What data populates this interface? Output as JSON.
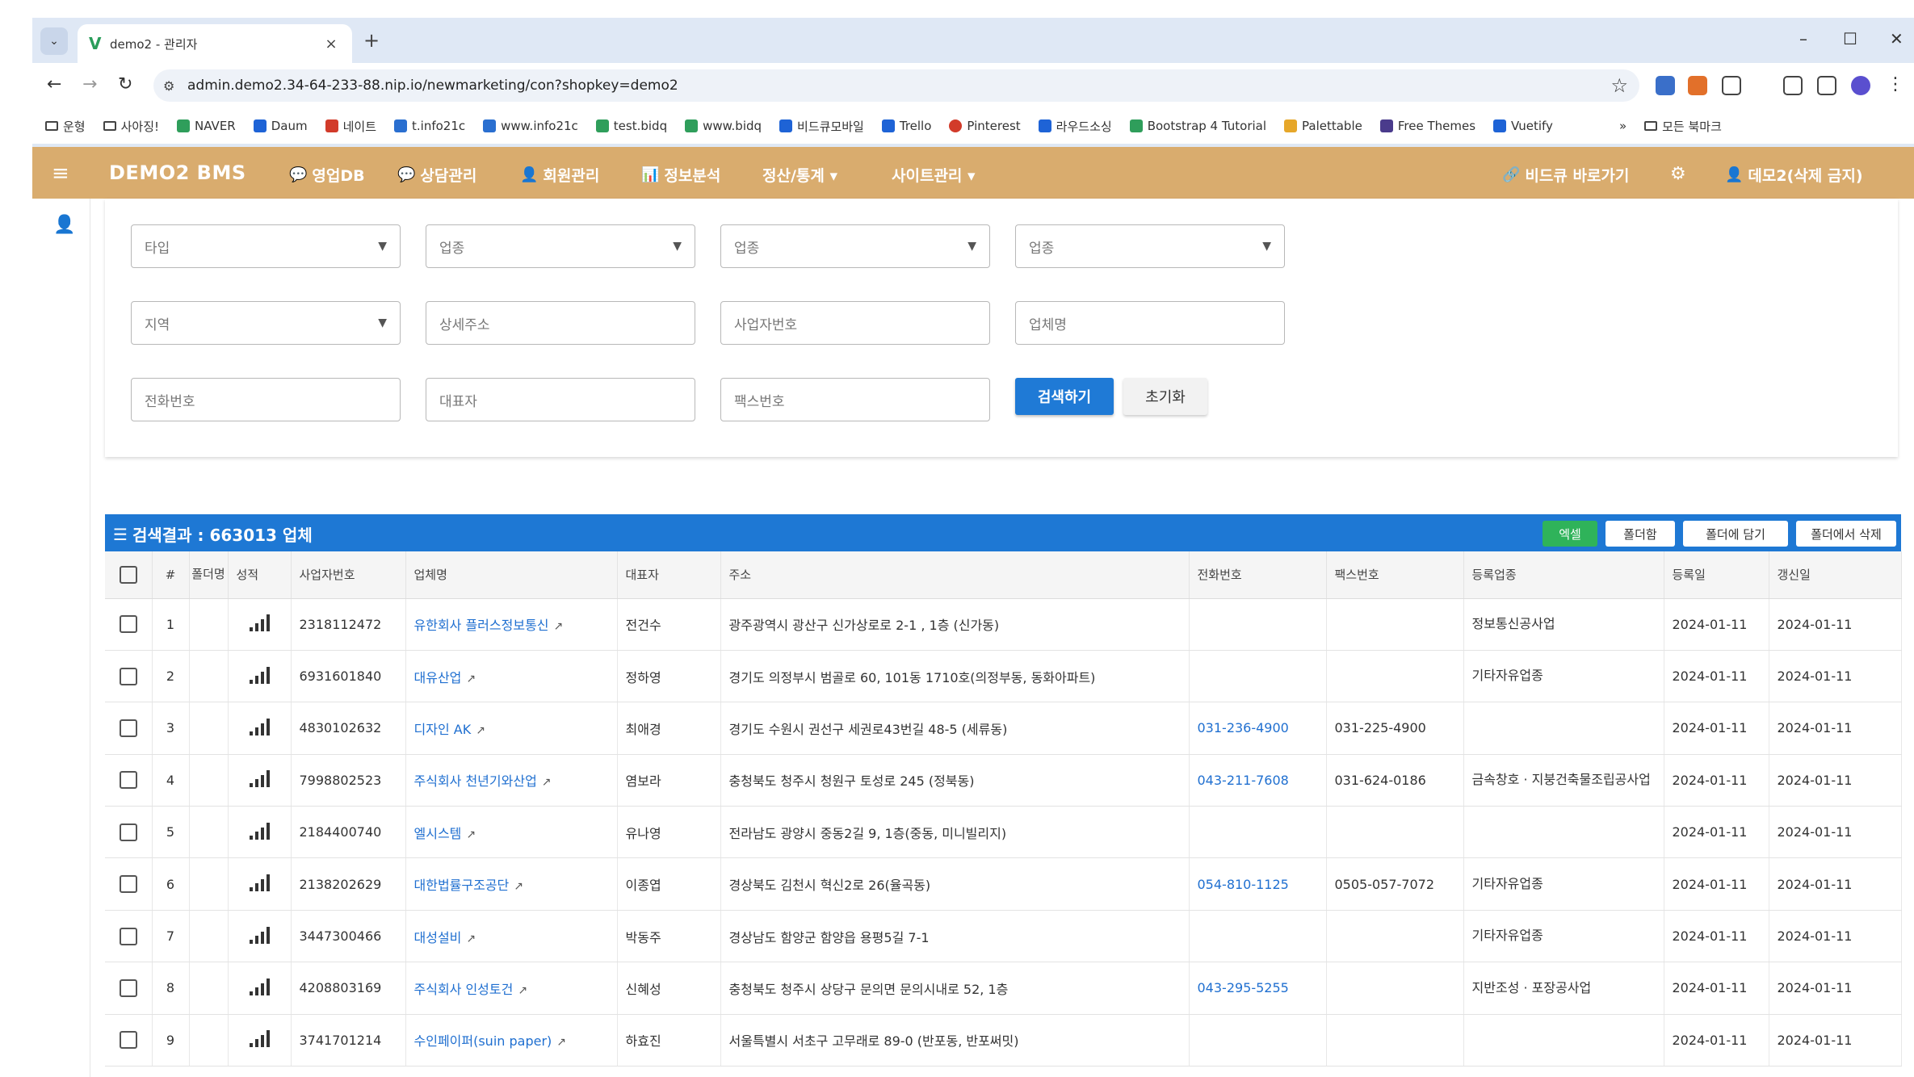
{
  "browser": {
    "tab_title": "demo2 - 관리자",
    "url": "admin.demo2.34-64-233-88.nip.io/newmarketing/con?shopkey=demo2",
    "bookmarks": [
      "운형",
      "사아징!",
      "NAVER",
      "Daum",
      "네이트",
      "t.info21c",
      "www.info21c",
      "test.bidq",
      "www.bidq",
      "비드큐모바일",
      "Trello",
      "Pinterest",
      "라우드소싱",
      "Bootstrap 4 Tutorial",
      "Palettable",
      "Free Themes",
      "Vuetify"
    ],
    "bookmarks_overflow": "»",
    "all_bookmarks": "모든 북마크",
    "bookmark_colors": [
      "#2f9e5b",
      "#1e63d6",
      "#d23b2a",
      "#2a6fd0",
      "#2a6fd0",
      "#2f9e5b",
      "#2f9e5b",
      "#1e63d6",
      "#1e63d6",
      "#d23b2a",
      "#1e63d6",
      "#2f9e5b",
      "#e6a72a",
      "#4a3b8c",
      "#1e63d6"
    ]
  },
  "app": {
    "brand": "DEMO2 BMS",
    "nav": [
      {
        "icon": "chat-icon",
        "label": "영업DB"
      },
      {
        "icon": "chat-icon",
        "label": "상담관리"
      },
      {
        "icon": "user-icon",
        "label": "회원관리"
      },
      {
        "icon": "chart-icon",
        "label": "정보분석"
      },
      {
        "icon": "",
        "label": "정산/통계 ▾"
      },
      {
        "icon": "",
        "label": "사이트관리 ▾"
      }
    ],
    "shortcut": "비드큐 바로가기",
    "user": "데모2(삭제 금지)",
    "accent": "#d9ac6e"
  },
  "search": {
    "row1": [
      "타입",
      "업종",
      "업종",
      "업종"
    ],
    "row2": [
      "지역",
      "상세주소",
      "사업자번호",
      "업체명"
    ],
    "row3": [
      "전화번호",
      "대표자",
      "팩스번호"
    ],
    "search_button": "검색하기",
    "reset_button": "초기화"
  },
  "results": {
    "title": "검색결과 : 663013 업체",
    "buttons": [
      "엑셀",
      "폴더함",
      "폴더에 담기",
      "폴더에서 삭제"
    ],
    "headers": [
      "#",
      "폴더명",
      "성적",
      "사업자번호",
      "업체명",
      "대표자",
      "주소",
      "전화번호",
      "팩스번호",
      "등록업종",
      "등록일",
      "갱신일"
    ],
    "rows": [
      {
        "no": "1",
        "biz": "2318112472",
        "name": "유한회사 플러스정보통신",
        "ceo": "전건수",
        "addr": "광주광역시 광산구 신가상로로 2-1 , 1층 (신가동)",
        "tel": "",
        "fax": "",
        "industry": "정보통신공사업",
        "reg": "2024-01-11",
        "upd": "2024-01-11"
      },
      {
        "no": "2",
        "biz": "6931601840",
        "name": "대유산업",
        "ceo": "정하영",
        "addr": "경기도 의정부시 범골로 60, 101동 1710호(의정부동, 동화아파트)",
        "tel": "",
        "fax": "",
        "industry": "기타자유업종",
        "reg": "2024-01-11",
        "upd": "2024-01-11"
      },
      {
        "no": "3",
        "biz": "4830102632",
        "name": "디자인 AK",
        "ceo": "최애경",
        "addr": "경기도 수원시 권선구 세권로43번길 48-5 (세류동)",
        "tel": "031-236-4900",
        "fax": "031-225-4900",
        "industry": "",
        "reg": "2024-01-11",
        "upd": "2024-01-11"
      },
      {
        "no": "4",
        "biz": "7998802523",
        "name": "주식회사 천년기와산업",
        "ceo": "염보라",
        "addr": "충청북도 청주시 청원구 토성로 245 (정북동)",
        "tel": "043-211-7608",
        "fax": "031-624-0186",
        "industry": "금속창호 · 지붕건축물조립공사업",
        "reg": "2024-01-11",
        "upd": "2024-01-11"
      },
      {
        "no": "5",
        "biz": "2184400740",
        "name": "엘시스템",
        "ceo": "유나영",
        "addr": "전라남도 광양시 중동2길 9, 1층(중동, 미니빌리지)",
        "tel": "",
        "fax": "",
        "industry": "",
        "reg": "2024-01-11",
        "upd": "2024-01-11"
      },
      {
        "no": "6",
        "biz": "2138202629",
        "name": "대한법률구조공단",
        "ceo": "이종엽",
        "addr": "경상북도 김천시 혁신2로 26(율곡동)",
        "tel": "054-810-1125",
        "fax": "0505-057-7072",
        "industry": "기타자유업종",
        "reg": "2024-01-11",
        "upd": "2024-01-11"
      },
      {
        "no": "7",
        "biz": "3447300466",
        "name": "대성설비",
        "ceo": "박동주",
        "addr": "경상남도 함양군 함양읍 용평5길 7-1",
        "tel": "",
        "fax": "",
        "industry": "기타자유업종",
        "reg": "2024-01-11",
        "upd": "2024-01-11"
      },
      {
        "no": "8",
        "biz": "4208803169",
        "name": "주식회사 인성토건",
        "ceo": "신혜성",
        "addr": "충청북도 청주시 상당구 문의면 문의시내로 52, 1층",
        "tel": "043-295-5255",
        "fax": "",
        "industry": "지반조성 · 포장공사업",
        "reg": "2024-01-11",
        "upd": "2024-01-11"
      },
      {
        "no": "9",
        "biz": "3741701214",
        "name": "수인페이퍼(suin paper)",
        "ceo": "하효진",
        "addr": "서울특별시 서초구 고무래로 89-0 (반포동, 반포써밋)",
        "tel": "",
        "fax": "",
        "industry": "",
        "reg": "2024-01-11",
        "upd": "2024-01-11"
      }
    ]
  }
}
